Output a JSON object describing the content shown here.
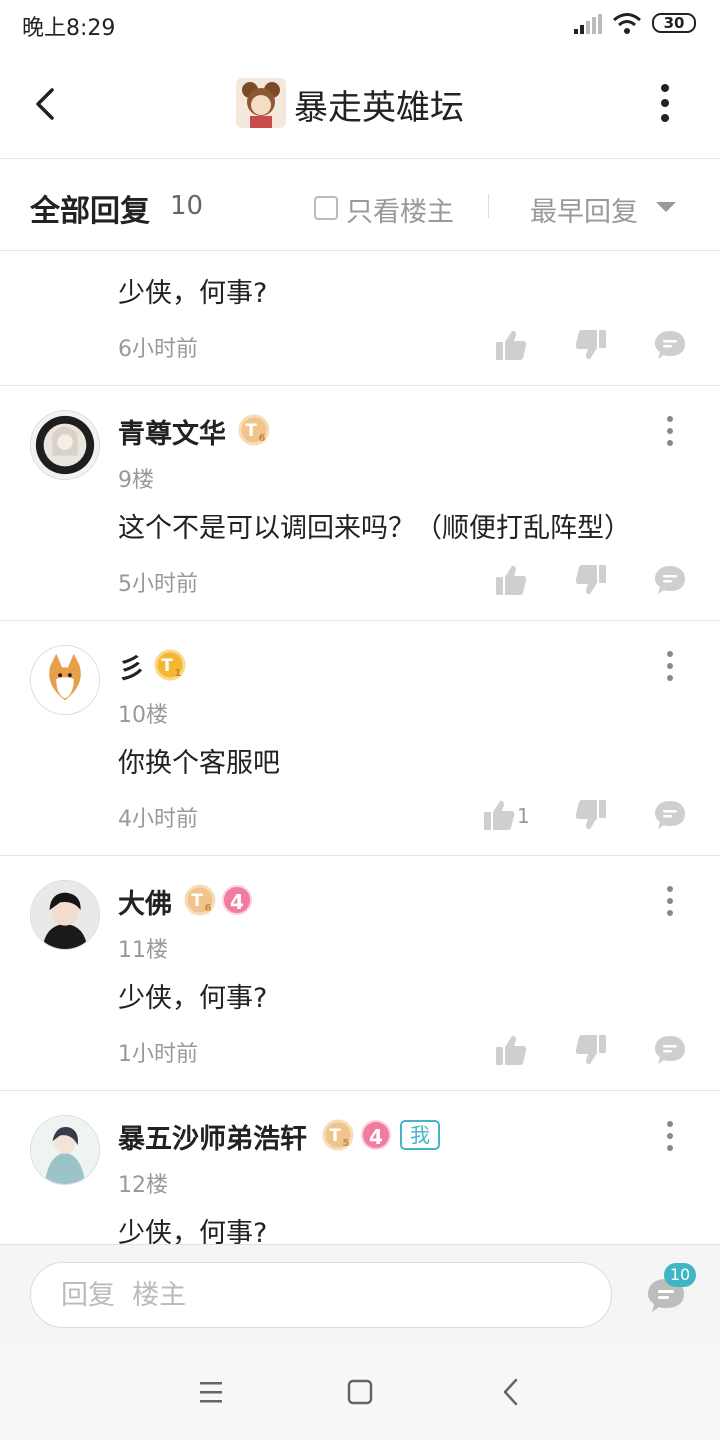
{
  "status": {
    "time": "晚上8:29",
    "battery": "30"
  },
  "header": {
    "title": "暴走英雄坛"
  },
  "filter": {
    "all_label": "全部回复",
    "count": "10",
    "only_owner": "只看楼主",
    "sort": "最早回复"
  },
  "posts": [
    {
      "text": "少侠，何事?",
      "time": "6小时前",
      "likes": ""
    },
    {
      "name": "青尊文华",
      "tlevel": "6",
      "floor": "9楼",
      "text": "这个不是可以调回来吗？（顺便打乱阵型）",
      "time": "5小时前",
      "likes": ""
    },
    {
      "name": "彡",
      "tlevel": "1",
      "floor": "10楼",
      "text": "你换个客服吧",
      "time": "4小时前",
      "likes": "1"
    },
    {
      "name": "大佛",
      "tlevel": "6",
      "level": "4",
      "floor": "11楼",
      "text": "少侠，何事?",
      "time": "1小时前",
      "likes": ""
    },
    {
      "name": "暴五沙师弟浩轩",
      "tlevel": "5",
      "level": "4",
      "me": "我",
      "floor": "12楼",
      "text": "少侠，何事?"
    }
  ],
  "reply": {
    "placeholder": "回复  楼主",
    "comment_count": "10"
  },
  "icons": {
    "back": "back-arrow-icon",
    "more": "more-vertical-icon",
    "like": "thumbs-up-icon",
    "dislike": "thumbs-down-icon",
    "comment": "comment-bubble-icon"
  },
  "colors": {
    "accent": "#3fb6c6",
    "gold": "#f0b04a",
    "pink": "#f37b9f",
    "icon_gray": "#cfcfcf"
  }
}
